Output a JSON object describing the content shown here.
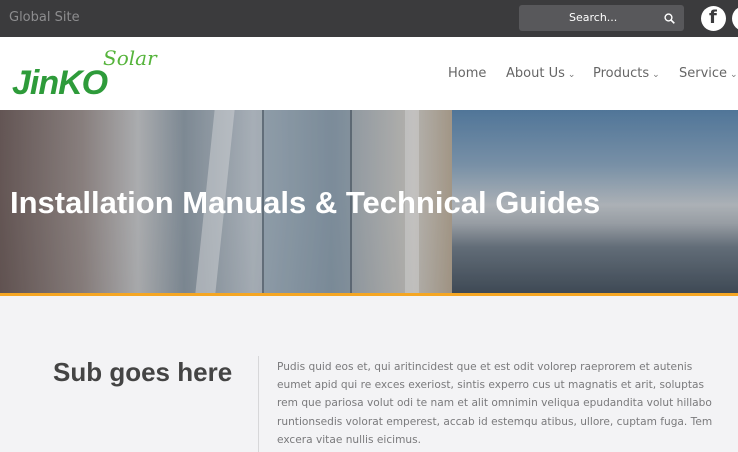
{
  "topbar": {
    "global_site": "Global Site",
    "search_placeholder": "Search..."
  },
  "header": {
    "logo": {
      "main": "JinKO",
      "accent": "Solar"
    },
    "nav": [
      {
        "label": "Home",
        "has_dropdown": false
      },
      {
        "label": "About Us",
        "has_dropdown": true
      },
      {
        "label": "Products",
        "has_dropdown": true
      },
      {
        "label": "Service",
        "has_dropdown": true
      }
    ]
  },
  "hero": {
    "title": "Installation Manuals & Technical Guides",
    "accent_color": "#f5a623"
  },
  "content": {
    "subheading": "Sub goes here",
    "paragraph": "Pudis quid eos et, qui aritincidest que et est odit volorep raeprorem et autenis eumet apid qui re exces exeriost, sintis experro cus ut magnatis et arit, soluptas rem que pariosa volut odi te nam et alit omnimin veliqua epudandita volut hillabo runtionsedis volorat emperest, accab id estemqu atibus, ullore, cuptam fuga. Tem excera vitae nullis eicimus."
  },
  "colors": {
    "topbar_bg": "#3b3b3d",
    "brand_green": "#2e9b3a",
    "accent_orange": "#f5a623"
  }
}
